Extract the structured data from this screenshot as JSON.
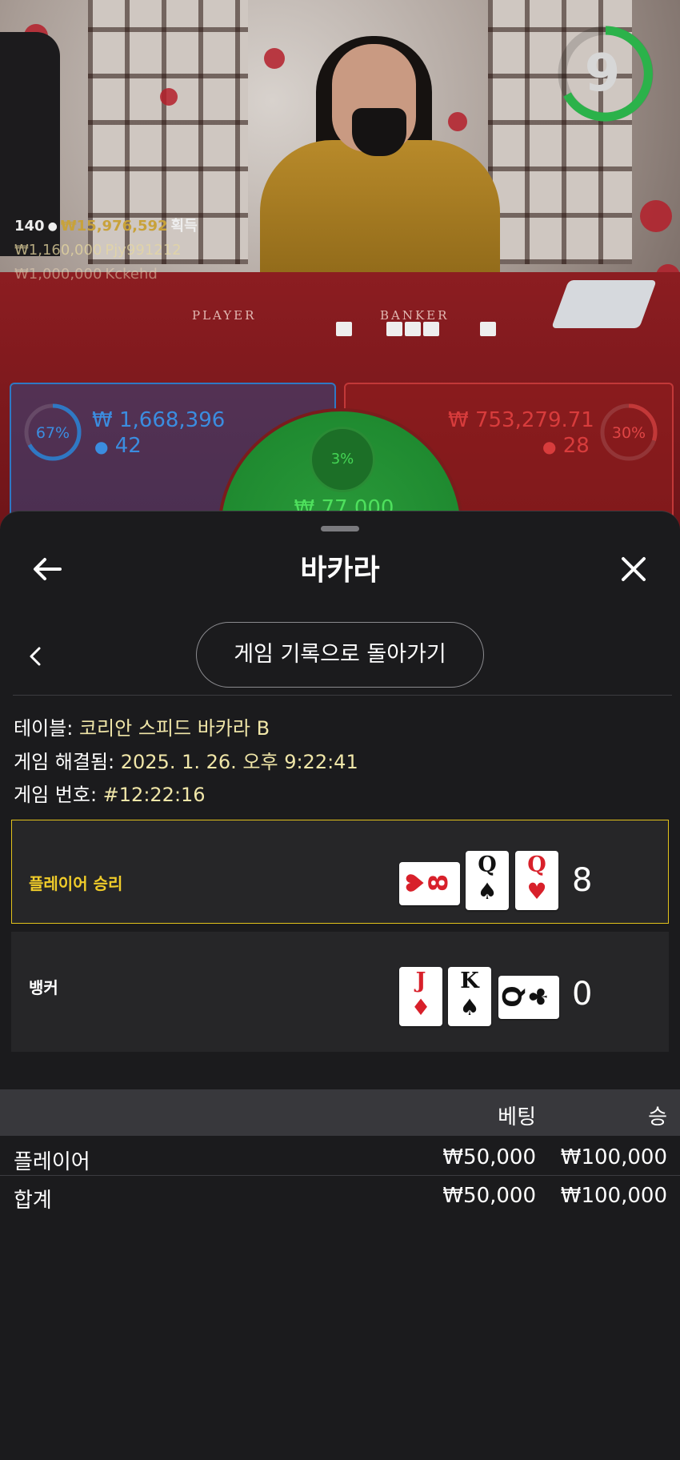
{
  "live_view": {
    "countdown": "9",
    "table_words": {
      "player": "PLAYER",
      "banker": "BANKER"
    },
    "stats": {
      "players": "140",
      "total_won": "₩15,976,592",
      "won_suffix": "획득",
      "winner1_amount": "₩1,160,000",
      "winner1_name": "Pjy991212",
      "winner2_amount": "₩1,000,000",
      "winner2_name": "Kckehd"
    },
    "player_bets": {
      "percent": "67%",
      "percent_value": 0.67,
      "amount": "₩ 1,668,396",
      "count": "42"
    },
    "banker_bets": {
      "percent": "30%",
      "percent_value": 0.3,
      "amount": "₩ 753,279.71",
      "count": "28"
    },
    "tie_bets": {
      "percent": "3%",
      "percent_value": 0.03,
      "amount": "₩ 77,000"
    },
    "colors": {
      "player": "#2f78c4",
      "banker": "#c23838",
      "tie": "#2a9a3a",
      "timer": "#2bb24a"
    }
  },
  "sheet": {
    "title": "바카라",
    "back_icon": "arrow-left-icon",
    "close_icon": "close-icon",
    "back_to_history_label": "게임 기록으로 돌아가기",
    "details": [
      {
        "label": "테이블: ",
        "value": "코리안 스피드 바카라 B"
      },
      {
        "label": "게임 해결됨: ",
        "value": "2025. 1. 26. 오후 9:22:41"
      },
      {
        "label": "게임 번호: ",
        "value": "#12:22:16"
      }
    ],
    "results": {
      "player": {
        "label": "플레이어 승리",
        "score": "8",
        "cards": [
          {
            "rank": "8",
            "suit": "♥",
            "orientation": "side"
          },
          {
            "rank": "Q",
            "suit": "♠",
            "orientation": "upright"
          },
          {
            "rank": "Q",
            "suit": "♥",
            "orientation": "upright"
          }
        ]
      },
      "banker": {
        "label": "뱅커",
        "score": "0",
        "cards": [
          {
            "rank": "J",
            "suit": "♦",
            "orientation": "upright"
          },
          {
            "rank": "K",
            "suit": "♠",
            "orientation": "upright"
          },
          {
            "rank": "Q",
            "suit": "♣",
            "orientation": "side"
          }
        ]
      }
    },
    "bets_table": {
      "headers": {
        "bet": "베팅",
        "win": "승"
      },
      "rows": [
        {
          "name": "플레이어",
          "bet": "₩50,000",
          "win": "₩100,000"
        }
      ],
      "total": {
        "name": "합계",
        "bet": "₩50,000",
        "win": "₩100,000"
      }
    },
    "accent_colors": {
      "win_border": "#e2c21b",
      "win_label": "#f0cc2a",
      "detail_value": "#f0e6a8"
    }
  }
}
